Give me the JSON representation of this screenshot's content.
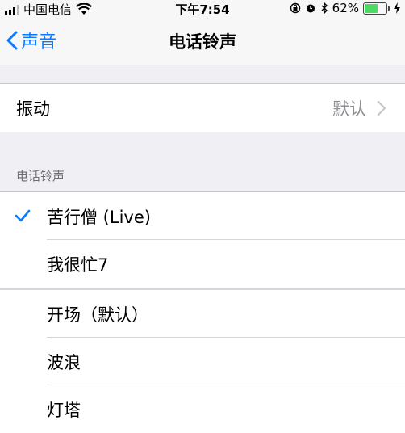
{
  "status_bar": {
    "carrier": "中国电信",
    "time": "下午7:54",
    "battery_percent": "62%",
    "battery_level": 0.62
  },
  "nav": {
    "back_label": "声音",
    "title": "电话铃声"
  },
  "vibration": {
    "label": "振动",
    "value": "默认"
  },
  "ringtones": {
    "section_header": "电话铃声",
    "items": [
      {
        "label": "苦行僧 (Live)",
        "selected": true
      },
      {
        "label": "我很忙7",
        "selected": false
      },
      {
        "label": "开场（默认）",
        "selected": false
      },
      {
        "label": "波浪",
        "selected": false
      },
      {
        "label": "灯塔",
        "selected": false
      }
    ]
  },
  "colors": {
    "accent": "#0a7aff",
    "battery": "#4cd964",
    "background": "#efeff4"
  }
}
